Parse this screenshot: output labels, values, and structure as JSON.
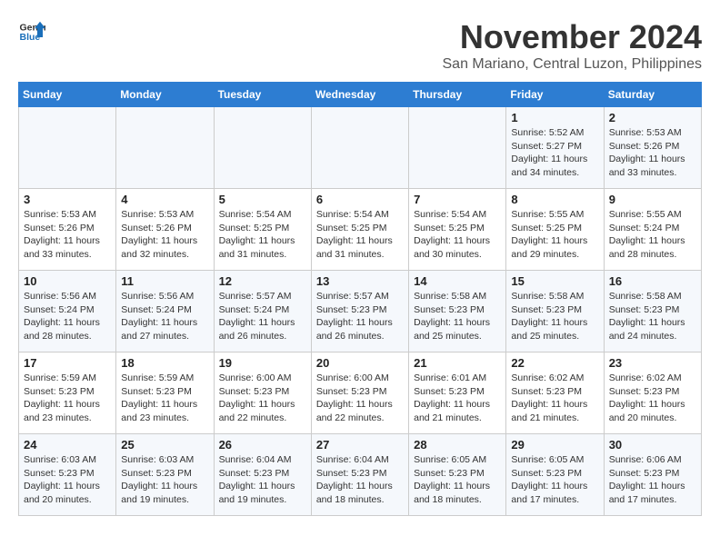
{
  "logo": {
    "line1": "General",
    "line2": "Blue"
  },
  "title": "November 2024",
  "subtitle": "San Mariano, Central Luzon, Philippines",
  "weekdays": [
    "Sunday",
    "Monday",
    "Tuesday",
    "Wednesday",
    "Thursday",
    "Friday",
    "Saturday"
  ],
  "weeks": [
    [
      {
        "day": "",
        "info": ""
      },
      {
        "day": "",
        "info": ""
      },
      {
        "day": "",
        "info": ""
      },
      {
        "day": "",
        "info": ""
      },
      {
        "day": "",
        "info": ""
      },
      {
        "day": "1",
        "info": "Sunrise: 5:52 AM\nSunset: 5:27 PM\nDaylight: 11 hours and 34 minutes."
      },
      {
        "day": "2",
        "info": "Sunrise: 5:53 AM\nSunset: 5:26 PM\nDaylight: 11 hours and 33 minutes."
      }
    ],
    [
      {
        "day": "3",
        "info": "Sunrise: 5:53 AM\nSunset: 5:26 PM\nDaylight: 11 hours and 33 minutes."
      },
      {
        "day": "4",
        "info": "Sunrise: 5:53 AM\nSunset: 5:26 PM\nDaylight: 11 hours and 32 minutes."
      },
      {
        "day": "5",
        "info": "Sunrise: 5:54 AM\nSunset: 5:25 PM\nDaylight: 11 hours and 31 minutes."
      },
      {
        "day": "6",
        "info": "Sunrise: 5:54 AM\nSunset: 5:25 PM\nDaylight: 11 hours and 31 minutes."
      },
      {
        "day": "7",
        "info": "Sunrise: 5:54 AM\nSunset: 5:25 PM\nDaylight: 11 hours and 30 minutes."
      },
      {
        "day": "8",
        "info": "Sunrise: 5:55 AM\nSunset: 5:25 PM\nDaylight: 11 hours and 29 minutes."
      },
      {
        "day": "9",
        "info": "Sunrise: 5:55 AM\nSunset: 5:24 PM\nDaylight: 11 hours and 28 minutes."
      }
    ],
    [
      {
        "day": "10",
        "info": "Sunrise: 5:56 AM\nSunset: 5:24 PM\nDaylight: 11 hours and 28 minutes."
      },
      {
        "day": "11",
        "info": "Sunrise: 5:56 AM\nSunset: 5:24 PM\nDaylight: 11 hours and 27 minutes."
      },
      {
        "day": "12",
        "info": "Sunrise: 5:57 AM\nSunset: 5:24 PM\nDaylight: 11 hours and 26 minutes."
      },
      {
        "day": "13",
        "info": "Sunrise: 5:57 AM\nSunset: 5:23 PM\nDaylight: 11 hours and 26 minutes."
      },
      {
        "day": "14",
        "info": "Sunrise: 5:58 AM\nSunset: 5:23 PM\nDaylight: 11 hours and 25 minutes."
      },
      {
        "day": "15",
        "info": "Sunrise: 5:58 AM\nSunset: 5:23 PM\nDaylight: 11 hours and 25 minutes."
      },
      {
        "day": "16",
        "info": "Sunrise: 5:58 AM\nSunset: 5:23 PM\nDaylight: 11 hours and 24 minutes."
      }
    ],
    [
      {
        "day": "17",
        "info": "Sunrise: 5:59 AM\nSunset: 5:23 PM\nDaylight: 11 hours and 23 minutes."
      },
      {
        "day": "18",
        "info": "Sunrise: 5:59 AM\nSunset: 5:23 PM\nDaylight: 11 hours and 23 minutes."
      },
      {
        "day": "19",
        "info": "Sunrise: 6:00 AM\nSunset: 5:23 PM\nDaylight: 11 hours and 22 minutes."
      },
      {
        "day": "20",
        "info": "Sunrise: 6:00 AM\nSunset: 5:23 PM\nDaylight: 11 hours and 22 minutes."
      },
      {
        "day": "21",
        "info": "Sunrise: 6:01 AM\nSunset: 5:23 PM\nDaylight: 11 hours and 21 minutes."
      },
      {
        "day": "22",
        "info": "Sunrise: 6:02 AM\nSunset: 5:23 PM\nDaylight: 11 hours and 21 minutes."
      },
      {
        "day": "23",
        "info": "Sunrise: 6:02 AM\nSunset: 5:23 PM\nDaylight: 11 hours and 20 minutes."
      }
    ],
    [
      {
        "day": "24",
        "info": "Sunrise: 6:03 AM\nSunset: 5:23 PM\nDaylight: 11 hours and 20 minutes."
      },
      {
        "day": "25",
        "info": "Sunrise: 6:03 AM\nSunset: 5:23 PM\nDaylight: 11 hours and 19 minutes."
      },
      {
        "day": "26",
        "info": "Sunrise: 6:04 AM\nSunset: 5:23 PM\nDaylight: 11 hours and 19 minutes."
      },
      {
        "day": "27",
        "info": "Sunrise: 6:04 AM\nSunset: 5:23 PM\nDaylight: 11 hours and 18 minutes."
      },
      {
        "day": "28",
        "info": "Sunrise: 6:05 AM\nSunset: 5:23 PM\nDaylight: 11 hours and 18 minutes."
      },
      {
        "day": "29",
        "info": "Sunrise: 6:05 AM\nSunset: 5:23 PM\nDaylight: 11 hours and 17 minutes."
      },
      {
        "day": "30",
        "info": "Sunrise: 6:06 AM\nSunset: 5:23 PM\nDaylight: 11 hours and 17 minutes."
      }
    ]
  ]
}
